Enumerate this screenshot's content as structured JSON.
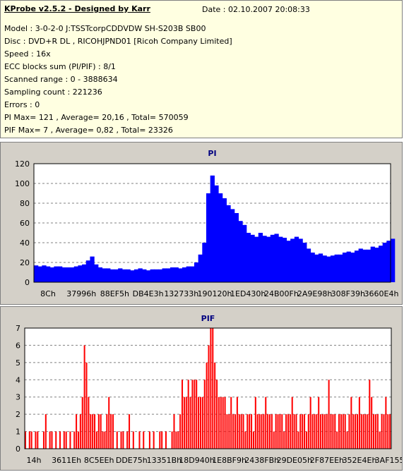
{
  "header": {
    "title": "KProbe v2.5.2 - Designed by Karr",
    "date": "Date : 02.10.2007 20:08:33"
  },
  "info": [
    "Model : 3-0-2-0 J:TSSTcorpCDDVDW SH-S203B  SB00",
    "Disc : DVD+R DL , RICOHJPND01 [Ricoh Company Limited]",
    "Speed : 16x",
    "ECC blocks sum (PI/PIF) : 8/1",
    "Scanned range : 0 - 3888634",
    "Sampling count : 221236",
    "Errors : 0",
    "PI Max= 121 , Average= 20,16 , Total= 570059",
    "PIF Max= 7 , Average= 0,82 , Total= 23326"
  ],
  "colors": {
    "panel_bg": "#ffffe1",
    "chart_bg": "#d4d0c8",
    "plot_bg": "#ffffff",
    "pi_color": "#0000ff",
    "pif_color": "#ff0000",
    "title_color": "#000080"
  },
  "chart_data": [
    {
      "type": "area",
      "title": "PI",
      "ylim": [
        0,
        120
      ],
      "yticks": [
        0,
        20,
        40,
        60,
        80,
        100,
        120
      ],
      "xticks": [
        "8Ch",
        "37996h",
        "88EF5h",
        "DB4E3h",
        "132733h",
        "190120h",
        "1ED430h",
        "24B00Fh",
        "2A9E98h",
        "308F39h",
        "3660E4h"
      ],
      "grid": true,
      "series": [
        {
          "values": [
            17,
            16,
            17,
            16,
            15,
            16,
            16,
            15,
            15,
            15,
            16,
            17,
            18,
            22,
            26,
            18,
            15,
            14,
            14,
            13,
            13,
            14,
            13,
            13,
            12,
            13,
            14,
            13,
            12,
            13,
            13,
            13,
            14,
            14,
            15,
            15,
            14,
            15,
            16,
            16,
            20,
            28,
            40,
            90,
            108,
            98,
            90,
            85,
            78,
            74,
            70,
            62,
            58,
            50,
            48,
            46,
            50,
            47,
            46,
            48,
            49,
            46,
            45,
            42,
            44,
            46,
            44,
            40,
            34,
            30,
            28,
            29,
            27,
            26,
            27,
            28,
            28,
            30,
            31,
            30,
            32,
            34,
            33,
            33,
            36,
            35,
            37,
            40,
            42,
            44
          ]
        }
      ]
    },
    {
      "type": "bar",
      "title": "PIF",
      "ylim": [
        0,
        7
      ],
      "yticks": [
        0,
        1,
        2,
        3,
        4,
        5,
        6,
        7
      ],
      "xticks": [
        "14h",
        "3611Eh",
        "8C5EEh",
        "DDE75h",
        "13351Bh",
        "18D940h",
        "1E8BF9h",
        "2438FBh",
        "29DE05h",
        "2F87EEh",
        "352E4Eh",
        "3AF155h"
      ],
      "grid": true,
      "series": [
        {
          "values": [
            1,
            0,
            1,
            1,
            0,
            1,
            1,
            0,
            0,
            1,
            2,
            0,
            1,
            1,
            0,
            1,
            0,
            1,
            0,
            1,
            1,
            0,
            1,
            0,
            1,
            2,
            1,
            2,
            3,
            6,
            5,
            3,
            2,
            2,
            2,
            1,
            2,
            2,
            1,
            1,
            2,
            3,
            2,
            2,
            0,
            1,
            0,
            1,
            1,
            0,
            1,
            2,
            0,
            1,
            0,
            0,
            1,
            0,
            1,
            0,
            0,
            1,
            0,
            1,
            0,
            0,
            1,
            1,
            0,
            1,
            0,
            0,
            1,
            2,
            1,
            1,
            2,
            4,
            3,
            3,
            4,
            3,
            4,
            4,
            4,
            3,
            3,
            3,
            4,
            5,
            6,
            7,
            7,
            5,
            4,
            3,
            3,
            3,
            3,
            2,
            2,
            3,
            2,
            2,
            3,
            2,
            2,
            2,
            1,
            2,
            2,
            2,
            1,
            3,
            2,
            2,
            2,
            2,
            3,
            2,
            2,
            2,
            1,
            2,
            2,
            2,
            2,
            1,
            2,
            2,
            2,
            3,
            2,
            2,
            1,
            2,
            2,
            2,
            1,
            2,
            3,
            2,
            2,
            2,
            3,
            2,
            2,
            2,
            2,
            4,
            2,
            2,
            2,
            1,
            2,
            2,
            2,
            2,
            1,
            2,
            3,
            2,
            2,
            2,
            3,
            2,
            2,
            2,
            2,
            4,
            3,
            2,
            2,
            2,
            1,
            2,
            2,
            3,
            2,
            2
          ]
        }
      ]
    }
  ]
}
